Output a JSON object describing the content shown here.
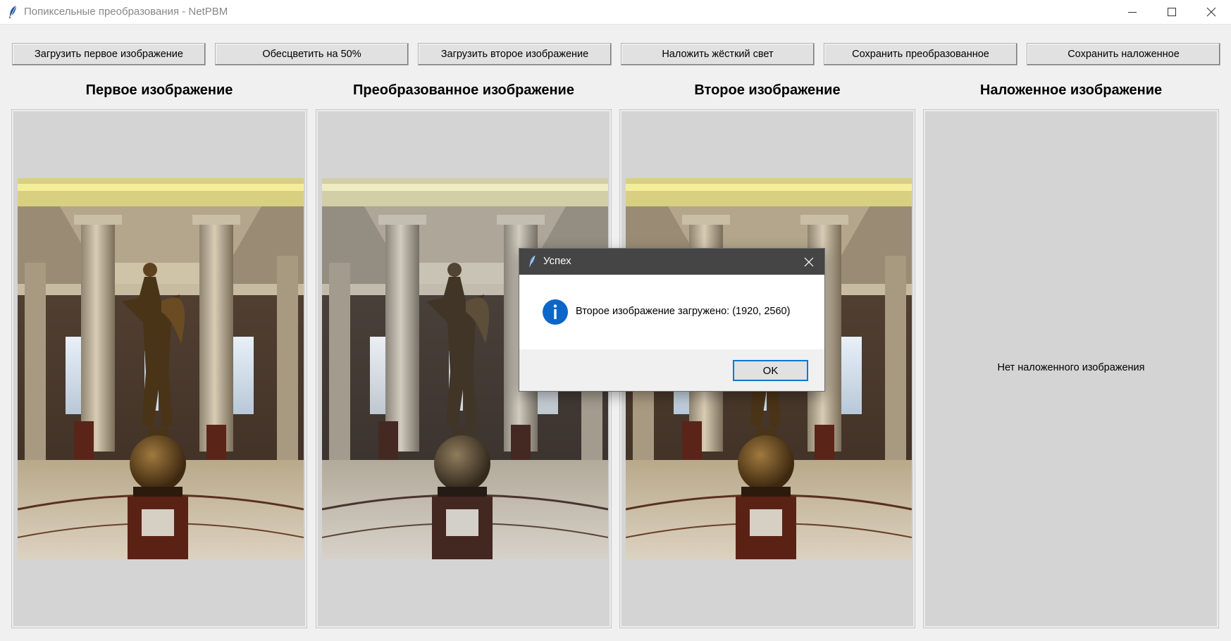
{
  "window": {
    "title": "Попиксельные преобразования - NetPBM",
    "app_icon": "feather-icon",
    "controls": [
      "minimize-icon",
      "maximize-icon",
      "close-icon"
    ]
  },
  "toolbar": {
    "buttons": [
      "Загрузить первое изображение",
      "Обесцветить на 50%",
      "Загрузить второе изображение",
      "Наложить жёсткий свет",
      "Сохранить преобразованное",
      "Сохранить наложенное"
    ]
  },
  "panels": [
    {
      "heading": "Первое изображение",
      "content": "photo-statue-hall"
    },
    {
      "heading": "Преобразованное изображение",
      "content": "photo-statue-hall-desaturated"
    },
    {
      "heading": "Второе изображение",
      "content": "photo-statue-hall"
    },
    {
      "heading": "Наложенное изображение",
      "empty_text": "Нет наложенного изображения"
    }
  ],
  "dialog": {
    "title": "Успех",
    "icon": "info-icon",
    "message": "Второе изображение загружено: (1920, 2560)",
    "ok_label": "OK"
  },
  "colors": {
    "window_bg": "#f0f0f0",
    "panel_bg": "#d4d4d4",
    "dialog_titlebar": "#454545",
    "accent": "#0078d7"
  }
}
